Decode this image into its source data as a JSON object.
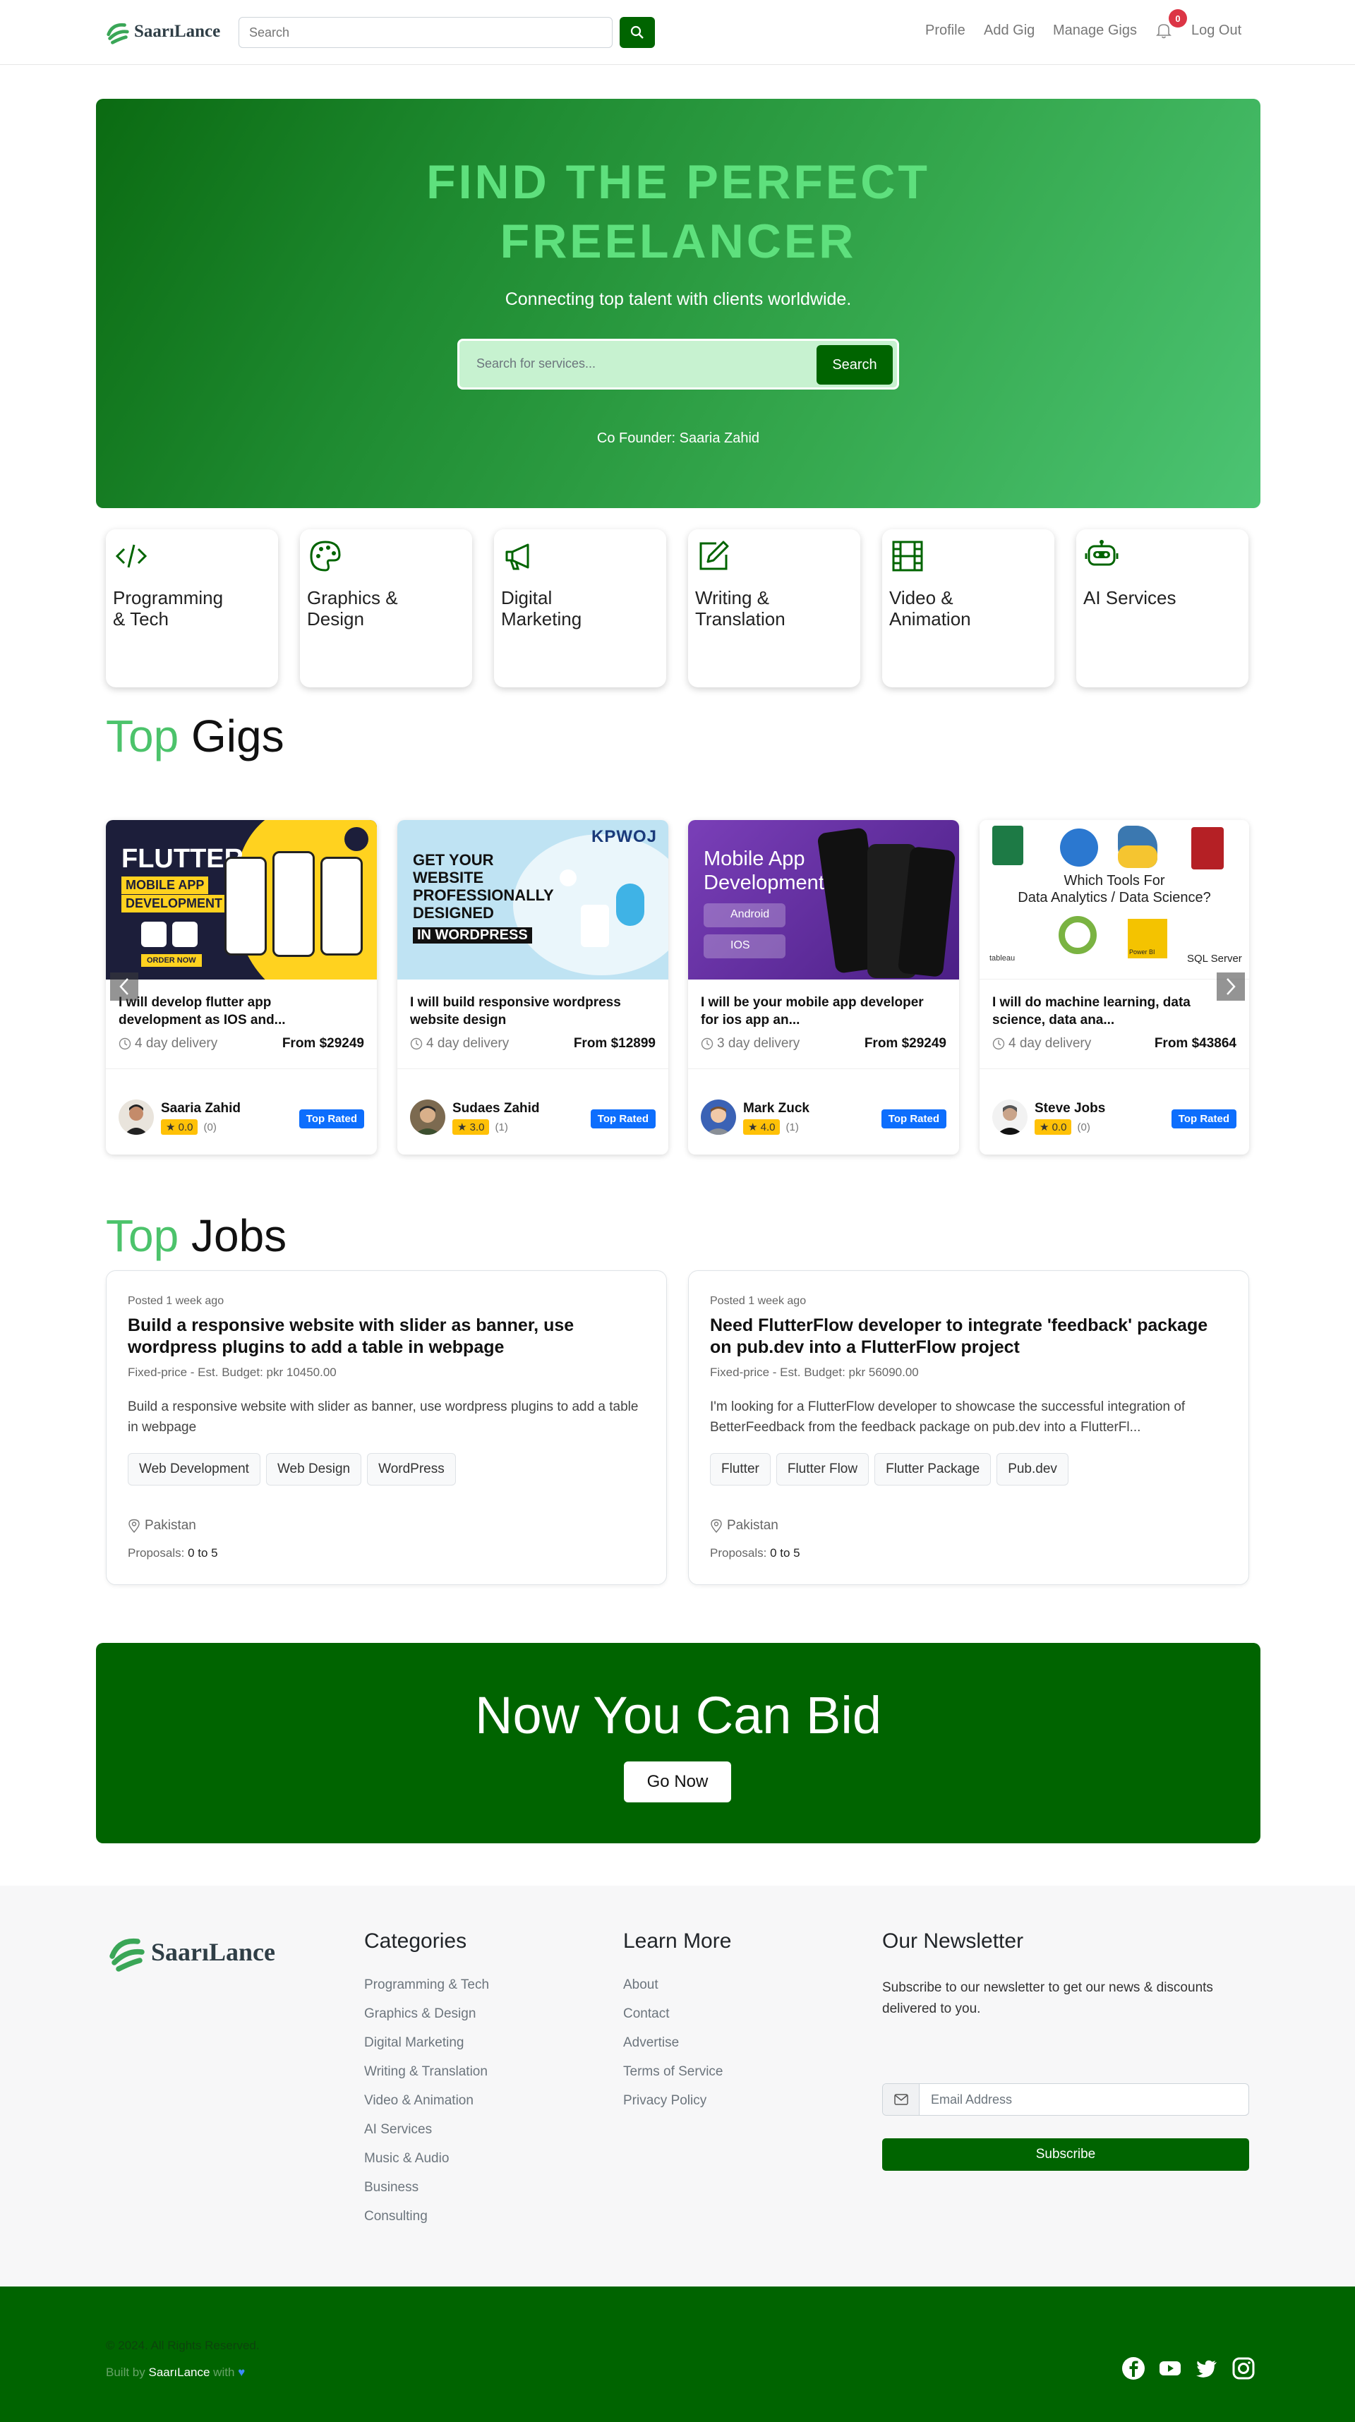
{
  "brand": {
    "name": "SaarıLance",
    "colors": {
      "primary": "#006400",
      "accent": "#4cc36b",
      "badge": "#0d6efd",
      "alert": "#dc3545"
    }
  },
  "nav": {
    "search_placeholder": "Search",
    "links": [
      "Profile",
      "Add Gig",
      "Manage Gigs"
    ],
    "notification_count": "0",
    "logout": "Log Out"
  },
  "hero": {
    "title_line1": "Find The Perfect",
    "title_line2": "Freelancer",
    "subtitle": "Connecting top talent with clients worldwide.",
    "search_placeholder": "Search for services...",
    "search_button": "Search",
    "cofounder": "Co Founder: Saaria Zahid"
  },
  "categories": [
    {
      "line1": "Programming",
      "line2": "& Tech",
      "icon": "code-icon"
    },
    {
      "line1": "Graphics &",
      "line2": "Design",
      "icon": "palette-icon"
    },
    {
      "line1": "Digital",
      "line2": "Marketing",
      "icon": "megaphone-icon"
    },
    {
      "line1": "Writing &",
      "line2": "Translation",
      "icon": "pencil-square-icon"
    },
    {
      "line1": "Video &",
      "line2": "Animation",
      "icon": "film-icon"
    },
    {
      "line1": "AI Services",
      "line2": "",
      "icon": "robot-icon"
    }
  ],
  "top_gigs": {
    "title_accent": "Top",
    "title_rest": "Gigs",
    "items": [
      {
        "image": {
          "line1": "FLUTTER",
          "line2": "MOBILE APP",
          "line3": "DEVELOPMENT",
          "cta": "ORDER NOW"
        },
        "title_line1": "I will develop flutter app",
        "title_line2": "development as IOS and...",
        "delivery": "4 day delivery",
        "price": "From $29249",
        "seller": "Saaria Zahid",
        "rating": "0.0",
        "reviews": "(0)",
        "badge": "Top Rated"
      },
      {
        "image": {
          "line1": "GET YOUR",
          "line2": "WEBSITE",
          "line3": "PROFESSIONALLY",
          "line4": "DESIGNED",
          "line5": "IN WORDPRESS",
          "logo": "KPWOJ"
        },
        "title_line1": "I will build responsive wordpress",
        "title_line2": "website design",
        "delivery": "4 day delivery",
        "price": "From $12899",
        "seller": "Sudaes Zahid",
        "rating": "3.0",
        "reviews": "(1)",
        "badge": "Top Rated"
      },
      {
        "image": {
          "line1": "Mobile App",
          "line2": "Development",
          "chip1": "Android",
          "chip2": "IOS"
        },
        "title_line1": "I will be your mobile app developer",
        "title_line2": "for ios app an...",
        "delivery": "3 day delivery",
        "price": "From $29249",
        "seller": "Mark Zuck",
        "rating": "4.0",
        "reviews": "(1)",
        "badge": "Top Rated"
      },
      {
        "image": {
          "line1": "Which Tools For",
          "line2": "Data Analytics / Data Science?",
          "l_tableau": "tableau",
          "l_powerbi": "Power BI",
          "l_sql": "SQL Server"
        },
        "title_line1": "I will do machine learning, data",
        "title_line2": "science, data ana...",
        "delivery": "4 day delivery",
        "price": "From $43864",
        "seller": "Steve Jobs",
        "rating": "0.0",
        "reviews": "(0)",
        "badge": "Top Rated"
      }
    ]
  },
  "top_jobs": {
    "title_accent": "Top",
    "title_rest": "Jobs",
    "items": [
      {
        "posted": "Posted 1 week ago",
        "title": "Build a responsive website with slider as banner, use wordpress plugins to add a table in webpage",
        "budget": "Fixed-price - Est. Budget: pkr 10450.00",
        "desc": "Build a responsive website with slider as banner, use wordpress plugins to add a table in webpage",
        "tags": [
          "Web Development",
          "Web Design",
          "WordPress"
        ],
        "location": "Pakistan",
        "proposals_label": "Proposals:",
        "proposals_value": "0 to 5"
      },
      {
        "posted": "Posted 1 week ago",
        "title": "Need FlutterFlow developer to integrate 'feedback' package on pub.dev into a FlutterFlow project",
        "budget": "Fixed-price - Est. Budget: pkr 56090.00",
        "desc": "I'm looking for a FlutterFlow developer to showcase the successful integration of BetterFeedback from the feedback package on pub.dev into a FlutterFl...",
        "tags": [
          "Flutter",
          "Flutter Flow",
          "Flutter Package",
          "Pub.dev"
        ],
        "location": "Pakistan",
        "proposals_label": "Proposals:",
        "proposals_value": "0 to 5"
      }
    ]
  },
  "bid": {
    "title": "Now You Can Bid",
    "button": "Go Now"
  },
  "footer": {
    "categories_title": "Categories",
    "categories": [
      "Programming & Tech",
      "Graphics & Design",
      "Digital Marketing",
      "Writing & Translation",
      "Video & Animation",
      "AI Services",
      "Music & Audio",
      "Business",
      "Consulting"
    ],
    "learn_title": "Learn More",
    "learn": [
      "About",
      "Contact",
      "Advertise",
      "Terms of Service",
      "Privacy Policy"
    ],
    "newsletter_title": "Our Newsletter",
    "newsletter_text": "Subscribe to our newsletter to get our news & discounts delivered to you.",
    "email_placeholder": "Email Address",
    "subscribe": "Subscribe",
    "copyright": "© 2024. All Rights Reserved.",
    "built_by_prefix": "Built by",
    "built_by_brand": "SaarıLance",
    "built_by_suffix": "with",
    "heart": "♥",
    "social_icons": [
      "facebook-icon",
      "youtube-icon",
      "twitter-icon",
      "instagram-icon"
    ]
  }
}
